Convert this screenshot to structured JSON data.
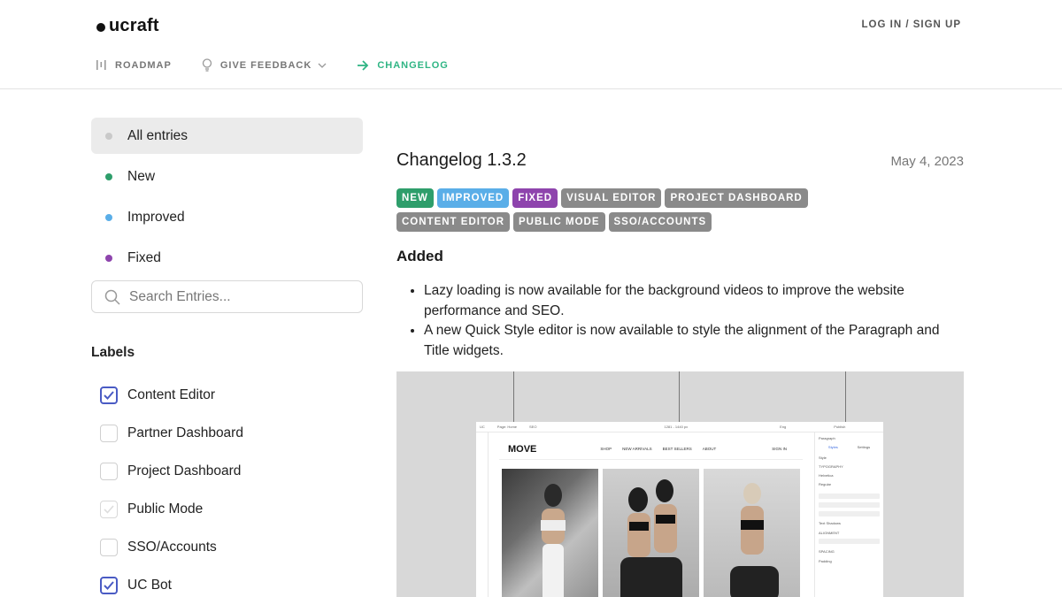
{
  "header": {
    "logo_text": "ucraft",
    "login_label": "LOG IN / SIGN UP",
    "nav": {
      "roadmap": "ROADMAP",
      "feedback": "GIVE FEEDBACK",
      "changelog": "CHANGELOG"
    },
    "accent_color": "#2fb584"
  },
  "sidebar": {
    "filters": [
      {
        "label": "All entries",
        "color": "#c9c9c9"
      },
      {
        "label": "New",
        "color": "#2e9e6b"
      },
      {
        "label": "Improved",
        "color": "#5aaee8"
      },
      {
        "label": "Fixed",
        "color": "#8e44ad"
      }
    ],
    "search_placeholder": "Search Entries...",
    "labels_title": "Labels",
    "labels": [
      {
        "label": "Content Editor",
        "checked": true
      },
      {
        "label": "Partner Dashboard",
        "checked": false
      },
      {
        "label": "Project Dashboard",
        "checked": false
      },
      {
        "label": "Public Mode",
        "checked": false
      },
      {
        "label": "SSO/Accounts",
        "checked": false
      },
      {
        "label": "UC Bot",
        "checked": true
      }
    ]
  },
  "entry": {
    "title": "Changelog 1.3.2",
    "date": "May 4, 2023",
    "tags": [
      {
        "label": "NEW",
        "color": "#2e9e6b"
      },
      {
        "label": "IMPROVED",
        "color": "#5aaee8"
      },
      {
        "label": "FIXED",
        "color": "#8e44ad"
      },
      {
        "label": "VISUAL EDITOR",
        "color": "#8a8a8a"
      },
      {
        "label": "PROJECT DASHBOARD",
        "color": "#8a8a8a"
      },
      {
        "label": "CONTENT EDITOR",
        "color": "#8a8a8a"
      },
      {
        "label": "PUBLIC MODE",
        "color": "#8a8a8a"
      },
      {
        "label": "SSO/ACCOUNTS",
        "color": "#8a8a8a"
      }
    ],
    "section_title": "Added",
    "bullets": [
      "Lazy loading is now available for the background videos to improve the website performance and SEO.",
      "A new Quick Style editor is now available to style the alignment of the Paragraph and Title widgets."
    ],
    "preview": {
      "topbar": [
        "UC",
        "Page: Home",
        "SEO",
        "1281 - 1440 px",
        "Eng",
        "Publish"
      ],
      "brand": "MOVE",
      "nav": [
        "SHOP",
        "NEW ARRIVALS",
        "BEST SELLERS",
        "ABOUT"
      ],
      "sign_in": "SIGN IN",
      "panel_title": "Paragraph",
      "panel_tabs": [
        "Styles",
        "Settings"
      ],
      "panel_rows": [
        "Style",
        "TYPOGRAPHY",
        "Helvetica",
        "Regular",
        "Text Shadows",
        "ALIGNMENT",
        "SPACING",
        "Padding"
      ]
    }
  }
}
